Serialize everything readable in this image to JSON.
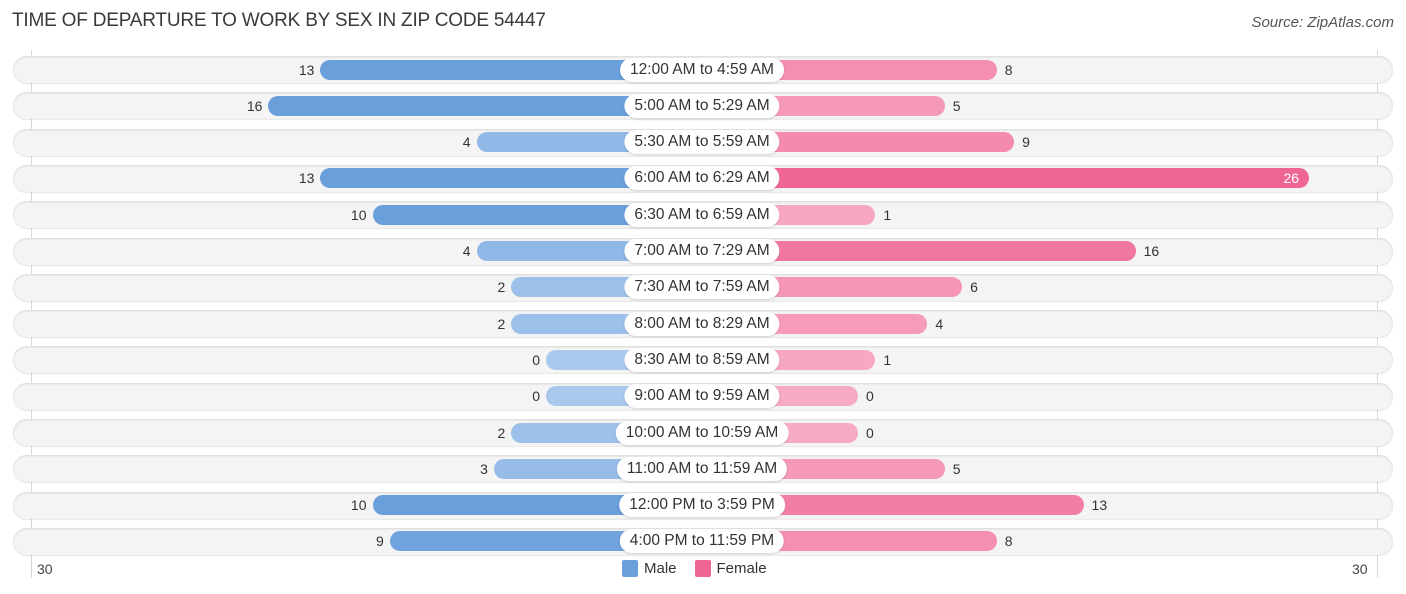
{
  "header": {
    "title": "TIME OF DEPARTURE TO WORK BY SEX IN ZIP CODE 54447",
    "source": "Source: ZipAtlas.com"
  },
  "colors": {
    "male_dark": "#6a9fdc",
    "male_light": "#a9c8ec",
    "female_dark": "#f06692",
    "female_light": "#f7aac3"
  },
  "chart_data": {
    "type": "bar",
    "orientation": "horizontal-diverging",
    "title": "TIME OF DEPARTURE TO WORK BY SEX IN ZIP CODE 54447",
    "categories": [
      "12:00 AM to 4:59 AM",
      "5:00 AM to 5:29 AM",
      "5:30 AM to 5:59 AM",
      "6:00 AM to 6:29 AM",
      "6:30 AM to 6:59 AM",
      "7:00 AM to 7:29 AM",
      "7:30 AM to 7:59 AM",
      "8:00 AM to 8:29 AM",
      "8:30 AM to 8:59 AM",
      "9:00 AM to 9:59 AM",
      "10:00 AM to 10:59 AM",
      "11:00 AM to 11:59 AM",
      "12:00 PM to 3:59 PM",
      "4:00 PM to 11:59 PM"
    ],
    "series": [
      {
        "name": "Male",
        "values": [
          13,
          16,
          4,
          13,
          10,
          4,
          2,
          2,
          0,
          0,
          2,
          3,
          10,
          9
        ]
      },
      {
        "name": "Female",
        "values": [
          8,
          5,
          9,
          26,
          1,
          16,
          6,
          4,
          1,
          0,
          0,
          5,
          13,
          8
        ]
      }
    ],
    "axis": {
      "left_tick": "30",
      "right_tick": "30",
      "max": 30
    },
    "legend": {
      "position": "bottom-center",
      "entries": [
        "Male",
        "Female"
      ]
    },
    "grid": false
  }
}
